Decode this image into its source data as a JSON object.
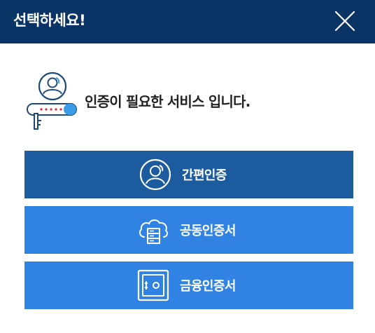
{
  "dialog": {
    "title": "선택하세요!",
    "close_icon": "close-icon"
  },
  "notice": {
    "icon": "user-key-icon",
    "text": "인증이 필요한 서비스 입니다."
  },
  "options": [
    {
      "label": "간편인증",
      "icon": "user-circle-icon",
      "color": "#1c5b9d"
    },
    {
      "label": "공동인증서",
      "icon": "cloud-server-icon",
      "color": "#3183e3"
    },
    {
      "label": "금융인증서",
      "icon": "safe-icon",
      "color": "#3183e3"
    }
  ],
  "colors": {
    "header": "#0b3466",
    "accent_dark": "#1c5b9d",
    "accent": "#3183e3",
    "notice_icon_outline": "#1b4a7a",
    "notice_icon_key": "#d92b3a"
  }
}
